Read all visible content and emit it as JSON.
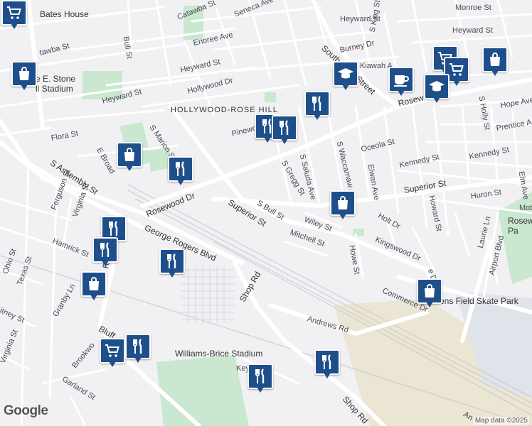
{
  "map": {
    "attribution": "Map data ©2025",
    "logo": "Google",
    "neighborhood": "HOLLYWOOD-ROSE HILL",
    "places": {
      "bates_house": "Bates House",
      "stone_stadium": "e E. Stone\nll Stadium",
      "williams_brice": "Williams-Brice Stadium",
      "rosewood_park": "Rosew\nPa",
      "skate_park": "ens Field Skate Park"
    },
    "streets": {
      "catawba": "Catawba St",
      "seneca": "Seneca Ave",
      "heyward_top": "Heyward St",
      "monroe": "Monroe St",
      "heyward_right": "Heyward St",
      "bull": "Bull St",
      "enoree": "Enoree Ave",
      "burney": "Burney Dr",
      "s_king": "S King St",
      "kiawah": "Kiawah A",
      "south_holly": "South Holly Street",
      "heyward_mid": "Heyward St",
      "hollywood": "Hollywood Dr",
      "heyward_left": "Heyward St",
      "tawba": "tawba St",
      "rosewood_dr_top": "Rosew",
      "s_holly": "S Holly St",
      "hope": "Hope Ave",
      "prentice": "Prentice A",
      "pinewood": "Pinewo",
      "s_marion": "S Marion St",
      "flora": "Flora St",
      "e_broad": "E Broad",
      "s_saluda": "S Saluda Ave",
      "s_waccamaw": "S Waccamaw Ave",
      "oceola": "Oceola St",
      "s_gregg": "S Gregg St",
      "elwan": "Elwan Ave",
      "kennedy_a": "Kennedy St",
      "kennedy_b": "Kennedy St",
      "elm": "Elm Ave",
      "superior_right": "Superior St",
      "huron": "Huron St",
      "mot": "Mot",
      "howard": "Howard St",
      "rosewood_dr": "Rosewood Dr",
      "s_assembly": "S Assembly St",
      "superior_left": "Superior St",
      "s_bull": "S Bull St",
      "wiley": "Wiley St",
      "holt": "Holt Dr",
      "ferguson": "Ferguson St",
      "virginia_top": "Virginia St",
      "george_rogers": "George Rogers Blvd",
      "mitchell": "Mitchell St",
      "kingswood": "Kingswood Dr",
      "hamrick": "Hamrick St",
      "rosewood_dr_v": "Rosewood Dr",
      "howe": "Howe St",
      "laurie": "Laurie Ln",
      "airport": "Airport Blvd",
      "ohio": "Ohio St",
      "texas": "Texas St",
      "e_dr": "e Dr",
      "commerce": "Commerce Dr",
      "shop_top": "Shop Rd",
      "whitney": "itney St",
      "granby": "Granby Ln",
      "andrews": "Andrews Rd",
      "bluff": "Bluff",
      "virginia_bottom": "Virginia St",
      "key": "Key",
      "garland": "Garland St",
      "brookwo": "Brookwo",
      "shop_bottom": "Shop Rd",
      "an": "An"
    }
  },
  "markers": [
    {
      "icon": "grocery-cart-icon"
    },
    {
      "icon": "shopping-bag-icon"
    },
    {
      "icon": "school-icon"
    },
    {
      "icon": "coffee-cup-icon"
    },
    {
      "icon": "restaurant-icon"
    },
    {
      "icon": "grocery-cart-icon"
    },
    {
      "icon": "restaurant-icon"
    },
    {
      "icon": "grocery-cart-icon"
    },
    {
      "icon": "shopping-bag-icon"
    },
    {
      "icon": "school-icon"
    },
    {
      "icon": "restaurant-icon"
    },
    {
      "icon": "shopping-bag-icon"
    },
    {
      "icon": "restaurant-icon"
    },
    {
      "icon": "shopping-bag-icon"
    },
    {
      "icon": "restaurant-icon"
    },
    {
      "icon": "restaurant-icon"
    },
    {
      "icon": "restaurant-icon"
    },
    {
      "icon": "shopping-bag-icon"
    },
    {
      "icon": "shopping-bag-icon"
    },
    {
      "icon": "grocery-cart-icon"
    },
    {
      "icon": "restaurant-icon"
    },
    {
      "icon": "restaurant-icon"
    },
    {
      "icon": "restaurant-icon"
    }
  ],
  "colors": {
    "background": "#f1f1f4",
    "road": "#ffffff",
    "park": "#c9e8cf",
    "marker": "#1e4f8a",
    "industrial": "#ebe5d4"
  }
}
